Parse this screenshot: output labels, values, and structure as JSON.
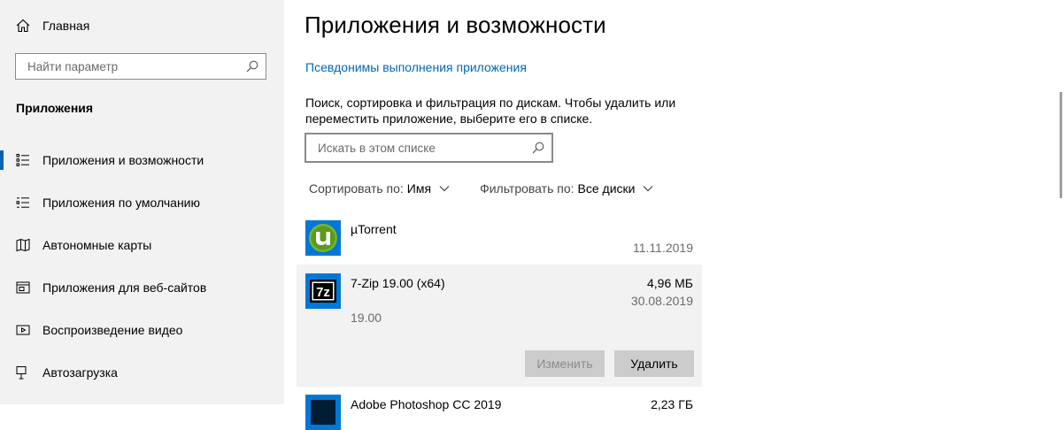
{
  "sidebar": {
    "home_label": "Главная",
    "search_placeholder": "Найти параметр",
    "section_title": "Приложения",
    "items": [
      {
        "label": "Приложения и возможности",
        "icon": "apps-features-icon",
        "active": true
      },
      {
        "label": "Приложения по умолчанию",
        "icon": "default-apps-icon",
        "active": false
      },
      {
        "label": "Автономные карты",
        "icon": "offline-maps-icon",
        "active": false
      },
      {
        "label": "Приложения для веб-сайтов",
        "icon": "apps-websites-icon",
        "active": false
      },
      {
        "label": "Воспроизведение видео",
        "icon": "video-playback-icon",
        "active": false
      },
      {
        "label": "Автозагрузка",
        "icon": "startup-icon",
        "active": false
      }
    ]
  },
  "main": {
    "title": "Приложения и возможности",
    "alias_link": "Псевдонимы выполнения приложения",
    "description": "Поиск, сортировка и фильтрация по дискам. Чтобы удалить или переместить приложение, выберите его в списке.",
    "search_placeholder": "Искать в этом списке",
    "sort_label": "Сортировать по:",
    "sort_value": "Имя",
    "filter_label": "Фильтровать по:",
    "filter_value": "Все диски",
    "apps": [
      {
        "name": "µTorrent",
        "size": "",
        "date": "11.11.2019",
        "version": "",
        "icon": "utorrent-icon"
      },
      {
        "name": "7-Zip 19.00 (x64)",
        "size": "4,96 МБ",
        "date": "30.08.2019",
        "version": "19.00",
        "icon": "7zip-icon"
      },
      {
        "name": "Adobe Photoshop CC 2019",
        "size": "2,23 ГБ",
        "date": "",
        "version": "",
        "icon": "photoshop-icon"
      }
    ],
    "buttons": {
      "modify": "Изменить",
      "uninstall": "Удалить"
    }
  },
  "colors": {
    "accent": "#0063b1",
    "link": "#0067b8",
    "sidebar_bg": "#f2f2f2",
    "selected_row_bg": "#f2f2f2",
    "app_tile_bg": "#0078d7",
    "utorrent_green": "#78b62a"
  }
}
